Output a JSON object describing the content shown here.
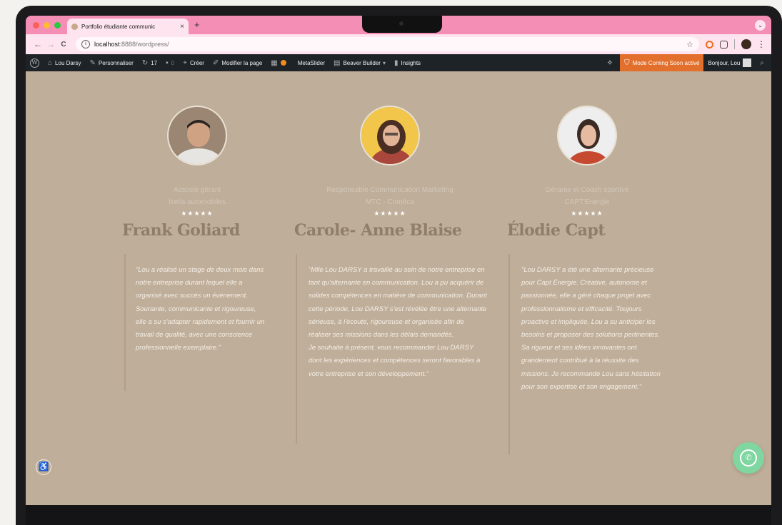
{
  "browser": {
    "tab_title": "Portfolio étudiante communic",
    "tab_close": "×",
    "new_tab": "+",
    "url_host": "localhost",
    "url_path": ":8888/wordpress/",
    "nav_back": "←",
    "nav_forward": "→",
    "nav_reload": "C"
  },
  "adminbar": {
    "site_name": "Lou Darsy",
    "customize": "Personnaliser",
    "updates": "17",
    "comments": "0",
    "new": "Créer",
    "edit_page": "Modifier la page",
    "metaslider": "MetaSlider",
    "beaver": "Beaver Builder",
    "insights": "Insights",
    "coming_soon": "Mode Coming Soon activé",
    "greeting": "Bonjour, Lou"
  },
  "testimonials": [
    {
      "role_line1": "Associé gérant",
      "role_line2": "Iselia automobiles",
      "stars": "★★★★★",
      "name": "Frank Goliard",
      "quote": "\"Lou a réalisé un stage de deux mois dans notre entreprise durant lequel elle a organisé avec succès un événement. Souriante, communicante et rigoureuse, elle a su s'adapter rapidement et fournir un travail de qualité, avec une conscience professionnelle exemplaire.\""
    },
    {
      "role_line1": "Responsable Communication Marketing",
      "role_line2": "MTC - Coméca",
      "stars": "★★★★★",
      "name": "Carole- Anne Blaise",
      "quote": "\"Mlle Lou DARSY a travaillé au sein de notre entreprise en tant qu'alternante en communication. Lou a pu acquérir de solides compétences en matière de communication. Durant cette période, Lou DARSY s'est révélée être une alternante sérieuse, à l'écoute, rigoureuse et organisée afin de réaliser ses missions dans les délais demandés.",
      "quote2": "Je souhaite à présent, vous recommander Lou DARSY dont les expériences et compétences seront favorables à votre entreprise et son développement.\""
    },
    {
      "role_line1": "Gérante et Coach sportive",
      "role_line2": "CAPT'Energie",
      "stars": "★★★★★",
      "name": "Élodie Capt",
      "quote": "\"Lou DARSY a été une alternante précieuse pour Capt Énergie. Créative, autonome et passionnée, elle a géré chaque projet avec professionnalisme et efficacité. Toujours proactive et impliquée, Lou a su anticiper les besoins et proposer des solutions pertinentes. Sa rigueur et ses idées innovantes ont grandement contribué à la réussite des missions. Je recommande Lou sans hésitation pour son expertise et son engagement.\""
    }
  ],
  "colors": {
    "page_bg": "#bfae99",
    "tab_bar": "#f48eb5",
    "admin_bar": "#1d2327",
    "coming_soon": "#e26f2c",
    "whatsapp": "#7fd6a0"
  },
  "icons": [
    "wordpress-icon",
    "home-icon",
    "brush-icon",
    "refresh-icon",
    "comment-icon",
    "plus-icon",
    "pencil-icon",
    "star-icon",
    "accessibility-icon",
    "whatsapp-icon",
    "search-icon"
  ]
}
